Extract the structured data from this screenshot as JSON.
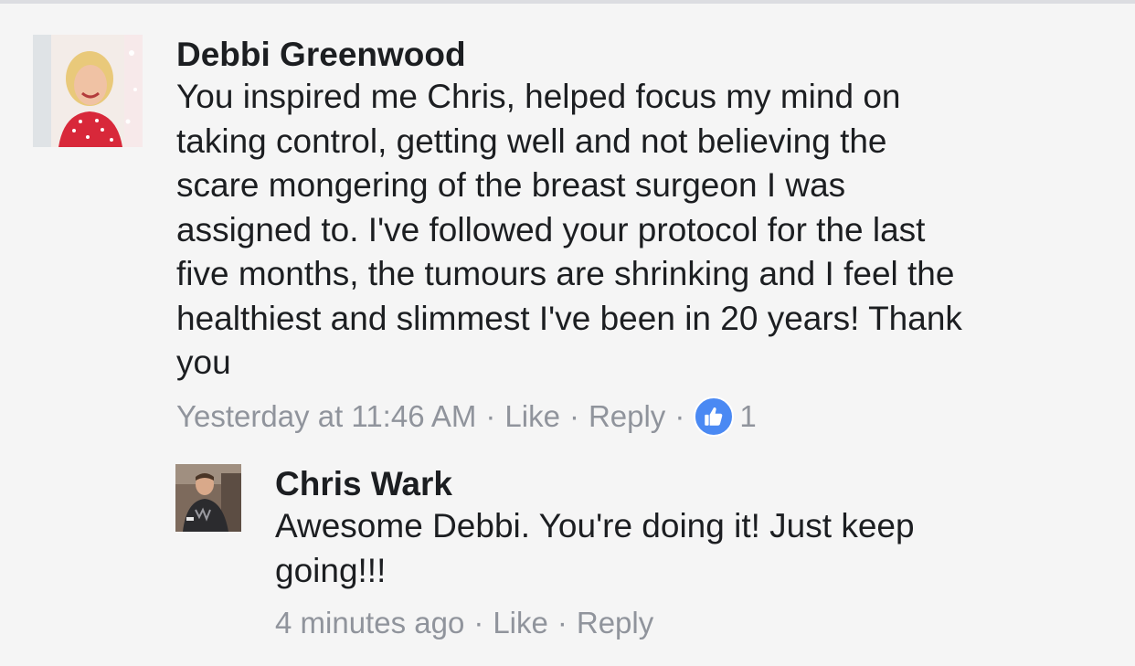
{
  "colors": {
    "background": "#f5f5f5",
    "text": "#1c1e21",
    "meta": "#90949c",
    "like_badge": "#4a89f3"
  },
  "comments": [
    {
      "author": "Debbi Greenwood",
      "text": "You inspired me Chris, helped focus my mind on\ntaking control, getting well and not believing the\nscare mongering of the breast surgeon I was\nassigned to.  I've followed your protocol for the last\nfive months, the tumours are shrinking and I feel the\nhealthiest and slimmest I've been in 20 years! Thank\nyou",
      "timestamp": "Yesterday at 11:46 AM",
      "like_label": "Like",
      "reply_label": "Reply",
      "separator": "·",
      "reaction_icon": "thumbs-up-icon",
      "reaction_count": "1"
    }
  ],
  "replies": [
    {
      "author": "Chris Wark",
      "text": "Awesome Debbi. You're doing it! Just keep\ngoing!!!",
      "timestamp": "4 minutes ago",
      "like_label": "Like",
      "reply_label": "Reply",
      "separator": "·"
    }
  ]
}
